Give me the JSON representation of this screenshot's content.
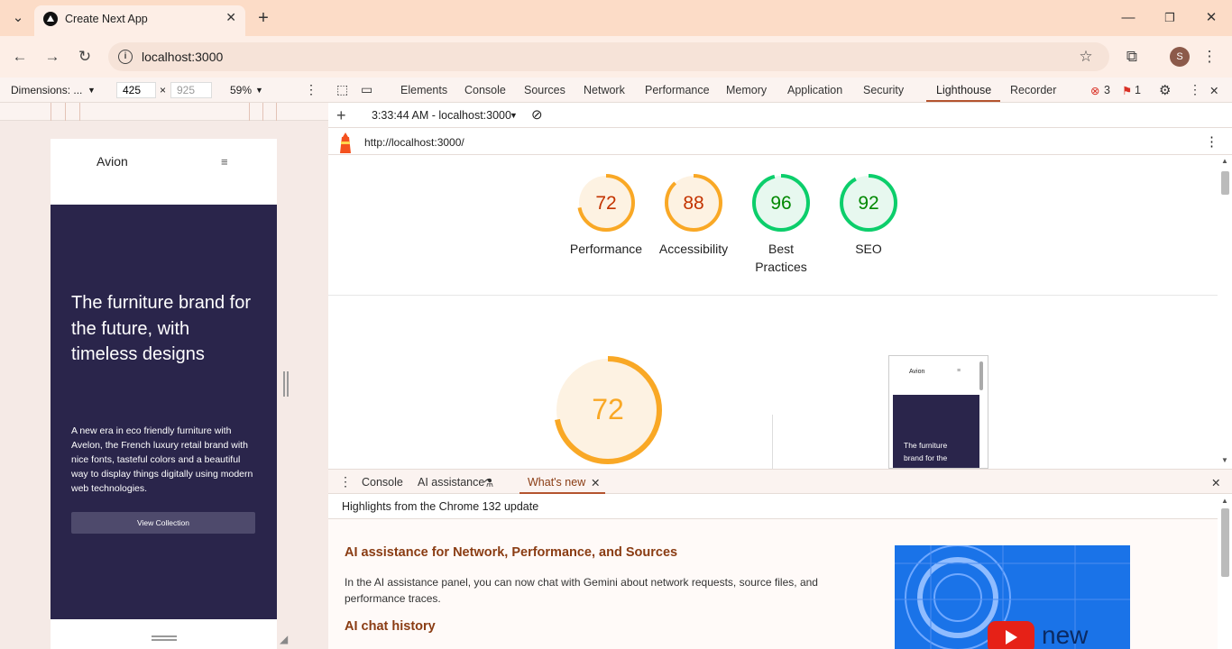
{
  "browser": {
    "tab_title": "Create Next App",
    "url": "localhost:3000",
    "profile_initial": "S"
  },
  "device_toolbar": {
    "dimensions_label": "Dimensions: ...",
    "width": "425",
    "height": "925",
    "zoom": "59%"
  },
  "site": {
    "logo": "Avion",
    "hero_heading": "The furniture brand for the future, with timeless designs",
    "hero_text": "A new era in eco friendly furniture with Avelon, the French luxury retail brand with nice fonts, tasteful colors and a beautiful way to display things digitally using modern web technologies.",
    "cta": "View Collection"
  },
  "devtools": {
    "tabs": [
      "Elements",
      "Console",
      "Sources",
      "Network",
      "Performance",
      "Memory",
      "Application",
      "Security",
      "Lighthouse",
      "Recorder"
    ],
    "active_tab": "Lighthouse",
    "errors": "3",
    "warnings": "1",
    "report_selector": "3:33:44 AM - localhost:3000",
    "report_url": "http://localhost:3000/"
  },
  "lighthouse": {
    "scores": [
      {
        "label": "Performance",
        "value": 72,
        "status": "average"
      },
      {
        "label": "Accessibility",
        "value": 88,
        "status": "average"
      },
      {
        "label": "Best Practices",
        "value": 96,
        "status": "pass"
      },
      {
        "label": "SEO",
        "value": 92,
        "status": "pass"
      }
    ],
    "main_score": 72,
    "thumb_logo": "Avion",
    "thumb_text": "The furniture brand for the future, with"
  },
  "drawer": {
    "tabs": [
      "Console",
      "AI assistance",
      "What's new"
    ],
    "active_tab": "What's new",
    "header": "Highlights from the Chrome 132 update",
    "section1_title": "AI assistance for Network, Performance, and Sources",
    "section1_text": "In the AI assistance panel, you can now chat with Gemini about network requests, source files, and performance traces.",
    "section2_title": "AI chat history",
    "video_text": "new"
  },
  "colors": {
    "average": "#f9a825",
    "average_text": "#c33300",
    "pass": "#0cce6b",
    "pass_text": "#008800",
    "hero_bg": "#2a254b"
  }
}
